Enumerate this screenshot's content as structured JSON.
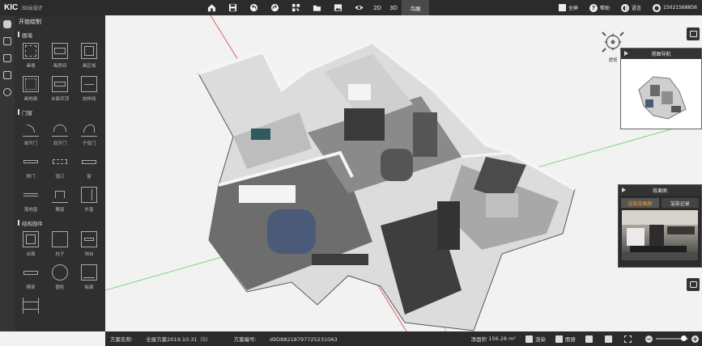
{
  "app": {
    "logo": "KIC",
    "name": "3D云设计"
  },
  "toolbar": {
    "view_2d": "2D",
    "view_3d": "3D",
    "active_mode": "鸟瞰"
  },
  "topright": {
    "fullscreen": "全屏",
    "help": "帮助",
    "language": "语言",
    "phone": "15021568856"
  },
  "panel": {
    "header": "开始绘制",
    "sections": [
      {
        "title": "画墙",
        "items": [
          "画墙",
          "画房间",
          "画区域",
          "画地面",
          "台面吊顶",
          "放样线"
        ]
      },
      {
        "title": "门窗",
        "items": [
          "单开门",
          "双开门",
          "子母门",
          "移门",
          "垭口",
          "窗",
          "落地窗",
          "飘窗",
          "外窗"
        ]
      },
      {
        "title": "结构部件",
        "items": [
          "台面",
          "柱子",
          "地台",
          "横梁",
          "圆柱",
          "板面"
        ]
      }
    ]
  },
  "compass": {
    "label": "透视"
  },
  "navigator": {
    "title": "视图导航"
  },
  "render_panel": {
    "title": "效果图",
    "tabs": [
      "渲染效果图",
      "渲染记录"
    ],
    "active_tab": 0
  },
  "status": {
    "project_name_label": "方案名称:",
    "project_name": "全屋方案2019.10.31（5）",
    "project_id_label": "方案编号:",
    "project_id": "d9D882187977252310A3",
    "area_label": "净面积",
    "area_value": "156.28 m²",
    "render_btn": "渲染",
    "drawing_btn": "图册"
  },
  "zoom": {
    "level": 0.85
  },
  "colors": {
    "bar": "#2b2b2b",
    "panel": "#2f2f2f",
    "accent": "#f0a020"
  }
}
